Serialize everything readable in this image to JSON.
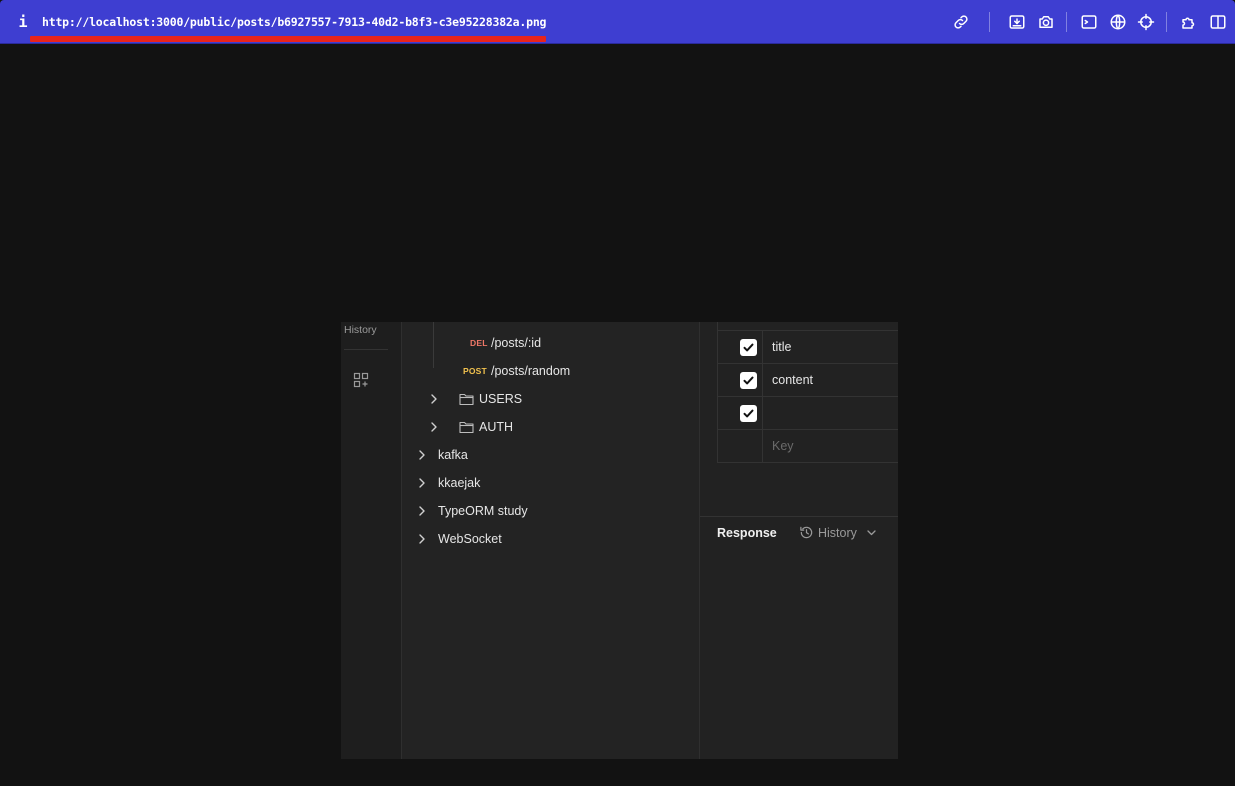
{
  "browser": {
    "info_glyph": "i",
    "url": "http://localhost:3000/public/posts/b6927557-7913-40d2-b8f3-c3e95228382a.png",
    "accent_color": "#3e3ed1",
    "underline_color": "#e8241c",
    "toolbar_icons": [
      "link-icon",
      "download-icon",
      "camera-icon",
      "terminal-icon",
      "globe-icon",
      "crosshair-icon",
      "puzzle-icon",
      "split-view-icon"
    ]
  },
  "sidebar": {
    "history_label": "History",
    "add_icon": "grid-add-icon"
  },
  "tree": {
    "requests": [
      {
        "method": "DEL",
        "method_color": "#f07868",
        "path": "/posts/:id"
      },
      {
        "method": "POST",
        "method_color": "#f2c24e",
        "path": "/posts/random"
      }
    ],
    "folders": [
      {
        "label": "USERS"
      },
      {
        "label": "AUTH"
      }
    ],
    "collections": [
      {
        "label": "kafka"
      },
      {
        "label": "kkaejak"
      },
      {
        "label": "TypeORM study"
      },
      {
        "label": "WebSocket"
      }
    ]
  },
  "params": {
    "rows": [
      {
        "checked": true,
        "key": "title"
      },
      {
        "checked": true,
        "key": "content"
      },
      {
        "checked": true,
        "key": ""
      }
    ],
    "key_placeholder": "Key"
  },
  "response": {
    "title": "Response",
    "history_label": "History"
  }
}
